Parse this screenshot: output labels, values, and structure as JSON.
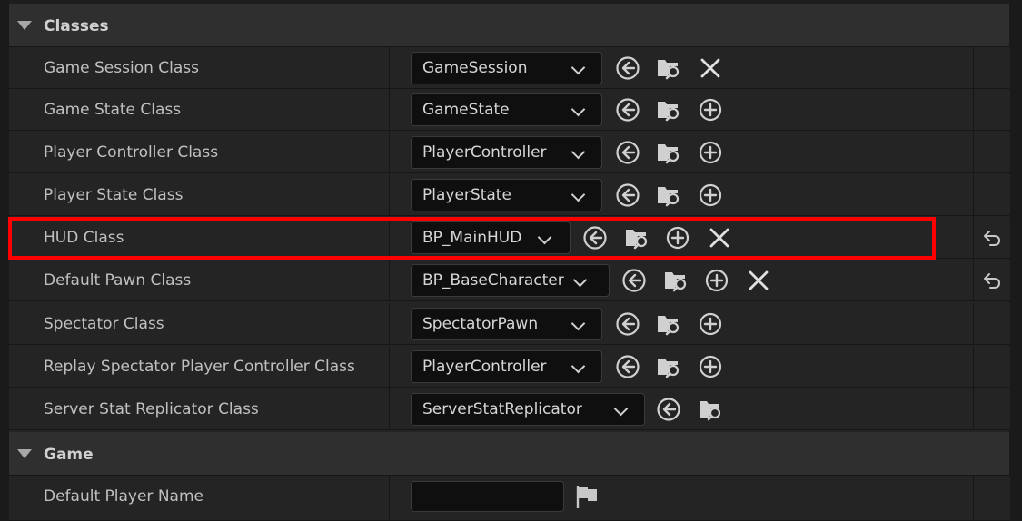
{
  "categories": {
    "classes": "Classes",
    "game": "Game"
  },
  "rows": {
    "game_session": {
      "label": "Game Session Class",
      "value": "GameSession"
    },
    "game_state": {
      "label": "Game State Class",
      "value": "GameState"
    },
    "player_controller": {
      "label": "Player Controller Class",
      "value": "PlayerController"
    },
    "player_state": {
      "label": "Player State Class",
      "value": "PlayerState"
    },
    "hud": {
      "label": "HUD Class",
      "value": "BP_MainHUD"
    },
    "default_pawn": {
      "label": "Default Pawn Class",
      "value": "BP_BaseCharacter"
    },
    "spectator": {
      "label": "Spectator Class",
      "value": "SpectatorPawn"
    },
    "replay_spectator": {
      "label": "Replay Spectator Player Controller Class",
      "value": "PlayerController"
    },
    "server_stat": {
      "label": "Server Stat Replicator Class",
      "value": "ServerStatReplicator"
    },
    "default_player_name": {
      "label": "Default Player Name",
      "value": ""
    }
  },
  "icons": {
    "use_selected": "browse-back-icon",
    "browse": "folder-search-icon",
    "add": "add-circle-icon",
    "clear": "clear-icon",
    "reset": "reset-to-default-icon",
    "flag": "localization-flag-icon"
  },
  "colors": {
    "highlight": "#ff0000",
    "background": "#242424",
    "input_bg": "#0f0f0f"
  }
}
